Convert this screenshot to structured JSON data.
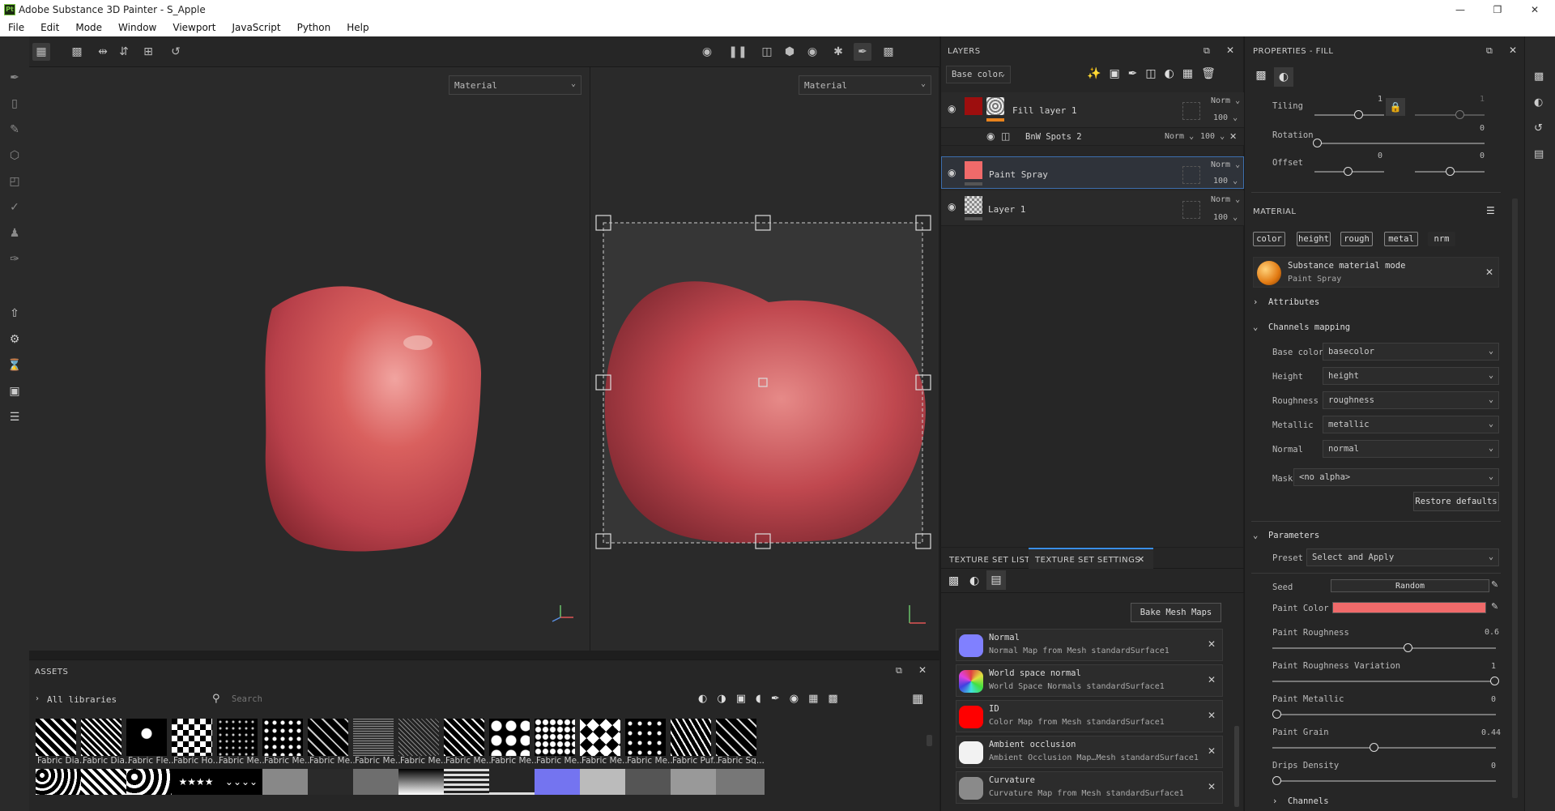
{
  "window": {
    "title": "Adobe Substance 3D Painter - S_Apple",
    "logo": "Pt"
  },
  "menu": [
    "File",
    "Edit",
    "Mode",
    "Window",
    "Viewport",
    "JavaScript",
    "Python",
    "Help"
  ],
  "viewport": {
    "left_select": "Material",
    "right_select": "Material"
  },
  "assets": {
    "title": "ASSETS",
    "library": "All libraries",
    "search_placeholder": "Search",
    "row1": [
      "Fabric Dia...",
      "Fabric Dia...",
      "Fabric Fle...",
      "Fabric Ho...",
      "Fabric Me...",
      "Fabric Me...",
      "Fabric Me...",
      "Fabric Me...",
      "Fabric Me...",
      "Fabric Me...",
      "Fabric Me...",
      "Fabric Me...",
      "Fabric Me...",
      "Fabric Me...",
      "Fabric Puf...",
      "Fabric Sq..."
    ]
  },
  "layers": {
    "title": "LAYERS",
    "channel": "Base color",
    "items": [
      {
        "name": "Fill layer 1",
        "mode": "Norm",
        "opacity": "100"
      },
      {
        "name": "BnW Spots 2",
        "mode": "Norm",
        "opacity": "100"
      },
      {
        "name": "Paint Spray",
        "mode": "Norm",
        "opacity": "100"
      },
      {
        "name": "Layer 1",
        "mode": "Norm",
        "opacity": "100"
      }
    ]
  },
  "texture_set": {
    "tab1": "TEXTURE SET LIST",
    "tab2": "TEXTURE SET SETTINGS",
    "bake_button": "Bake Mesh Maps",
    "maps": [
      {
        "title": "Normal",
        "subtitle": "Normal Map from Mesh standardSurface1",
        "color": "#8080ff"
      },
      {
        "title": "World space normal",
        "subtitle": "World Space Normals standardSurface1",
        "color": "#66cc66"
      },
      {
        "title": "ID",
        "subtitle": "Color Map from Mesh standardSurface1",
        "color": "#ff0000"
      },
      {
        "title": "Ambient occlusion",
        "subtitle": "Ambient Occlusion Map…Mesh standardSurface1",
        "color": "#f2f2f2"
      },
      {
        "title": "Curvature",
        "subtitle": "Curvature Map from Mesh standardSurface1",
        "color": "#8a8a8a"
      }
    ]
  },
  "properties": {
    "title": "PROPERTIES - FILL",
    "tiling_label": "Tiling",
    "tiling_value": "1",
    "tiling_value2": "1",
    "rotation_label": "Rotation",
    "rotation_value": "0",
    "offset_label": "Offset",
    "offset_value1": "0",
    "offset_value2": "0",
    "material_header": "MATERIAL",
    "chips": [
      "color",
      "height",
      "rough",
      "metal",
      "nrm"
    ],
    "material_mode_title": "Substance material mode",
    "material_mode_sub": "Paint Spray",
    "attributes": "Attributes",
    "channels_mapping": "Channels mapping",
    "mapping": [
      {
        "label": "Base color",
        "value": "basecolor"
      },
      {
        "label": "Height",
        "value": "height"
      },
      {
        "label": "Roughness",
        "value": "roughness"
      },
      {
        "label": "Metallic",
        "value": "metallic"
      },
      {
        "label": "Normal",
        "value": "normal"
      }
    ],
    "mask_label": "Mask",
    "mask_value": "<no alpha>",
    "restore_defaults": "Restore defaults",
    "parameters": "Parameters",
    "preset_label": "Preset",
    "preset_value": "Select and Apply",
    "seed_label": "Seed",
    "seed_value": "Random",
    "paint_color_label": "Paint Color",
    "paint_color": "#f06a6a",
    "paint_roughness_label": "Paint Roughness",
    "paint_roughness_value": "0.6",
    "paint_roughness_variation_label": "Paint Roughness Variation",
    "paint_roughness_variation_value": "1",
    "paint_metallic_label": "Paint Metallic",
    "paint_metallic_value": "0",
    "paint_grain_label": "Paint Grain",
    "paint_grain_value": "0.44",
    "drips_density_label": "Drips Density",
    "drips_density_value": "0",
    "channels": "Channels"
  }
}
